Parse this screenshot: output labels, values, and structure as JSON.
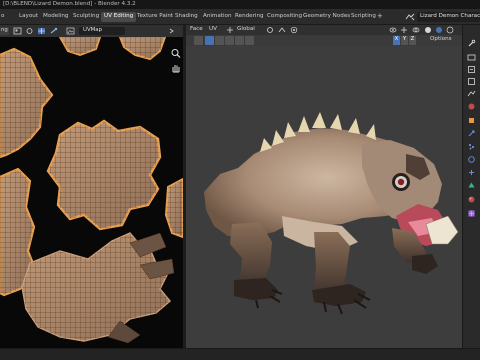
{
  "window": {
    "title": "[D:\\BLEND\\Lizard Demon.blend] - Blender 4.3.2"
  },
  "topbar": {
    "menu_item": "o",
    "workspaces": [
      "Layout",
      "Modeling",
      "Sculpting",
      "UV Editing",
      "Texture Paint",
      "Shading",
      "Animation",
      "Rendering",
      "Compositing",
      "Geometry Nodes",
      "Scripting"
    ],
    "active_workspace": "UV Editing",
    "add_workspace": "+",
    "scene_name": "Lizard Demon Character"
  },
  "uv_editor": {
    "header_label": "ng",
    "uv_map": "UVMap",
    "icons": [
      "uv-select-mode-icon",
      "sticky-selection-icon",
      "uv-map-icon",
      "pin-icon",
      "image-browse-icon"
    ],
    "side_icons": [
      "zoom-icon",
      "pan-hand-icon"
    ]
  },
  "viewport": {
    "header": [
      "Face",
      "UV"
    ],
    "transform_orientation": "Global",
    "options_label": "Options",
    "gizmo_axes": [
      "X",
      "Y",
      "Z"
    ]
  },
  "properties": {
    "icons": [
      "tool-icon",
      "render-icon",
      "output-icon",
      "view-layer-icon",
      "scene-icon",
      "world-icon",
      "object-icon",
      "modifier-icon",
      "particles-icon",
      "physics-icon",
      "constraints-icon",
      "data-icon",
      "material-icon",
      "texture-icon"
    ]
  },
  "colors": {
    "accent": "#4772b3",
    "active_tab": "#4a4a4a",
    "viewport_bg": "#3d3d3d",
    "uv_bg": "#080808",
    "mesh_orange": "#d38a4a"
  }
}
